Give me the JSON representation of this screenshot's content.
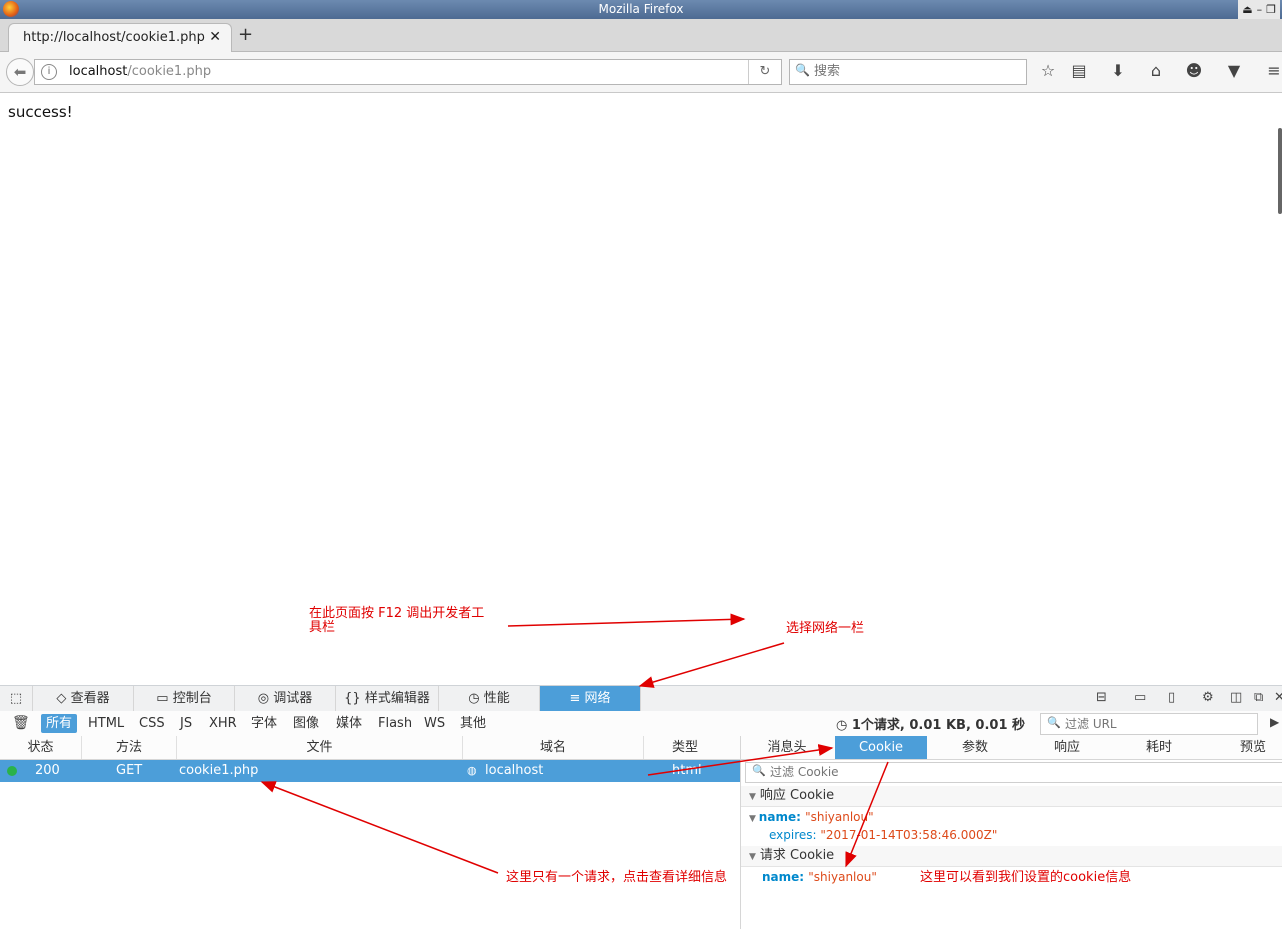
{
  "window": {
    "title": "Mozilla Firefox"
  },
  "tab": {
    "title": "http://localhost/cookie1.php"
  },
  "urlbar": {
    "host": "localhost",
    "path": "/cookie1.php"
  },
  "search": {
    "placeholder": "搜索"
  },
  "page": {
    "body_text": "success!"
  },
  "annotations": {
    "f12": "在此页面按 F12 调出开发者工\n具栏",
    "network": "选择网络一栏",
    "request": "这里只有一个请求，点击查看详细信息",
    "cookie": "这里可以看到我们设置的cookie信息"
  },
  "devtools": {
    "tabs": [
      "查看器",
      "控制台",
      "调试器",
      "样式编辑器",
      "性能",
      "网络"
    ],
    "selected_tab": "网络",
    "filters": [
      "所有",
      "HTML",
      "CSS",
      "JS",
      "XHR",
      "字体",
      "图像",
      "媒体",
      "Flash",
      "WS",
      "其他"
    ],
    "summary": "1个请求, 0.01 KB, 0.01 秒",
    "url_filter_placeholder": "过滤 URL",
    "columns": [
      "状态",
      "方法",
      "文件",
      "域名",
      "类型"
    ],
    "request": {
      "status": "200",
      "method": "GET",
      "file": "cookie1.php",
      "domain": "localhost",
      "type": "html"
    },
    "side_tabs": [
      "消息头",
      "Cookie",
      "参数",
      "响应",
      "耗时",
      "预览"
    ],
    "cookie_filter_placeholder": "过滤 Cookie",
    "response_cookie": {
      "heading": "响应 Cookie",
      "name_key": "name",
      "name_value": "\"shiyanlou\"",
      "expires_key": "expires",
      "expires_value": "\"2017-01-14T03:58:46.000Z\""
    },
    "request_cookie": {
      "heading": "请求 Cookie",
      "name_key": "name",
      "name_value": "\"shiyanlou\""
    }
  },
  "colors": {
    "accent": "#4c9ed9",
    "annotation": "#e00000",
    "status_ok": "#2ab24a"
  }
}
